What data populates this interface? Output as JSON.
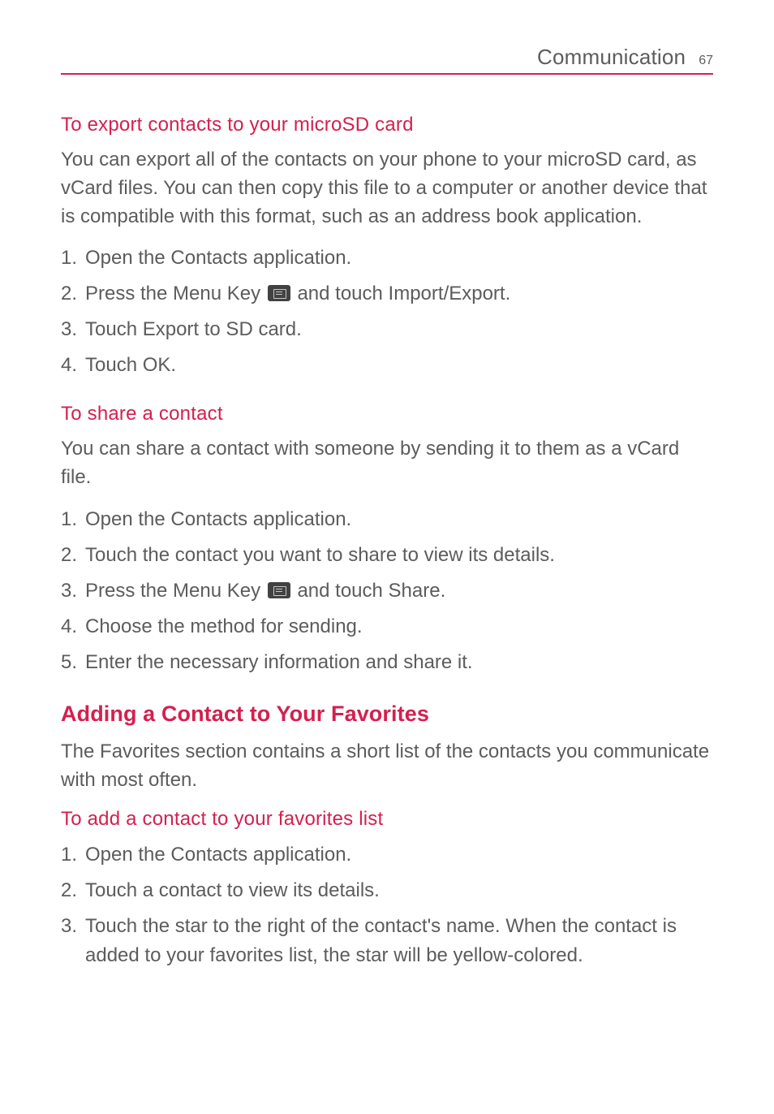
{
  "header": {
    "title": "Communication",
    "page_number": "67"
  },
  "sections": {
    "export": {
      "heading": "To export contacts to your microSD card",
      "intro": "You can export all of the contacts on your phone to your microSD card, as vCard files. You can then copy this file to a computer or another device that is compatible with this format, such as an address book application.",
      "step1_pre": "Open the ",
      "step1_bold": "Contacts",
      "step1_post": " application.",
      "step2_pre": "Press the ",
      "step2_bold1": "Menu Key",
      "step2_mid": " and touch ",
      "step2_bold2": "Import/Export",
      "step2_post": ".",
      "step3_pre": "Touch ",
      "step3_bold": "Export to SD card",
      "step3_post": ".",
      "step4_pre": "Touch ",
      "step4_bold": "OK",
      "step4_post": "."
    },
    "share": {
      "heading": "To share a contact",
      "intro": "You can share a contact with someone by sending it to them as a vCard file.",
      "step1_pre": "Open the ",
      "step1_bold": "Contacts",
      "step1_post": " application.",
      "step2": "Touch the contact you want to share to view its details.",
      "step3_pre": "Press the ",
      "step3_bold1": "Menu Key",
      "step3_mid": " and touch ",
      "step3_bold2": "Share",
      "step3_post": ".",
      "step4": "Choose the method for sending.",
      "step5": "Enter the necessary information and share it."
    },
    "favorites": {
      "main_heading": "Adding a Contact to Your Favorites",
      "intro_pre": "The ",
      "intro_bold": "Favorites",
      "intro_post": " section contains a short list of the contacts you communicate with most often.",
      "sub_heading": "To add a contact to your favorites list",
      "step1_pre": "Open the ",
      "step1_bold": "Contacts",
      "step1_post": " application.",
      "step2": "Touch a contact to view its details.",
      "step3": "Touch the star to the right of the contact's name. When the contact is added to your favorites list, the star will be yellow-colored."
    }
  }
}
